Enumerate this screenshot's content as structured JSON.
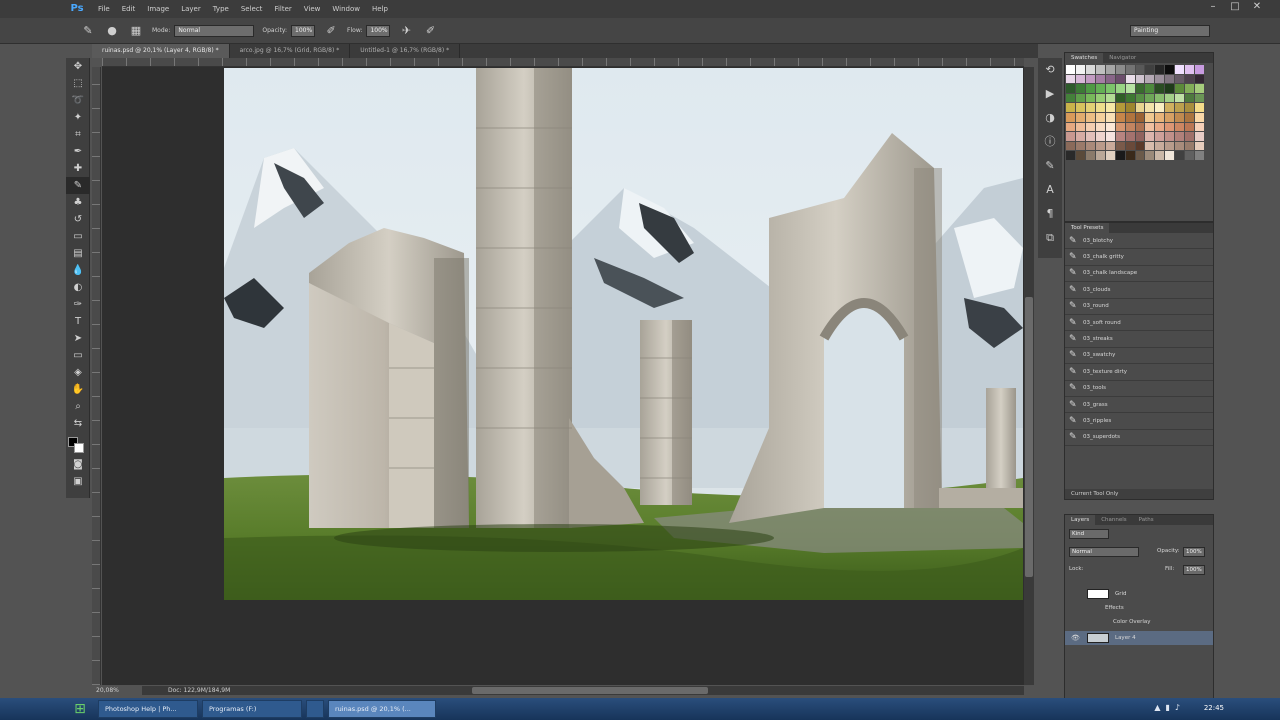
{
  "app": {
    "logo": "Ps"
  },
  "menu": [
    "File",
    "Edit",
    "Image",
    "Layer",
    "Type",
    "Select",
    "Filter",
    "View",
    "Window",
    "Help"
  ],
  "window_controls": {
    "minimize": "–",
    "maximize": "□",
    "close": "✕"
  },
  "options": {
    "mode_label": "Mode:",
    "mode_value": "Normal",
    "opacity_label": "Opacity:",
    "opacity_value": "100%",
    "flow_label": "Flow:",
    "flow_value": "100%",
    "workspace": "Painting"
  },
  "tabs": [
    {
      "label": "ruinas.psd @ 20,1% (Layer 4, RGB/8) *",
      "active": true
    },
    {
      "label": "arco.jpg @ 16,7% (Grid, RGB/8) *",
      "active": false
    },
    {
      "label": "Untitled-1 @ 16,7% (RGB/8) *",
      "active": false
    }
  ],
  "status": {
    "zoom": "20,08%",
    "doc": "Doc: 122,9M/184,9M"
  },
  "swatches": {
    "colors": [
      "#ffffff",
      "#f2f2f2",
      "#d9d9d9",
      "#bfbfbf",
      "#a6a6a6",
      "#8c8c8c",
      "#737373",
      "#595959",
      "#404040",
      "#262626",
      "#0d0d0d",
      "#f0e0ff",
      "#e0c0f0",
      "#c89be0",
      "#e8d6e8",
      "#d7b8d7",
      "#c29bc2",
      "#a57ea5",
      "#886588",
      "#6b4d6b",
      "#e9dde9",
      "#cfc3cf",
      "#b5a9b5",
      "#9b8f9b",
      "#817581",
      "#675b67",
      "#4d414d",
      "#332733",
      "#2e5a2b",
      "#3d7a36",
      "#4f9a44",
      "#64b055",
      "#7cc46a",
      "#99d584",
      "#b7e3a3",
      "#3a6b2f",
      "#4d8a3c",
      "#2a4d22",
      "#1f3b1a",
      "#5c8a3a",
      "#82ad58",
      "#a6cc7c",
      "#44803a",
      "#5e9e4a",
      "#78b85a",
      "#96cc74",
      "#b3dc94",
      "#2f5e26",
      "#3e7832",
      "#568f44",
      "#6ea658",
      "#88bc6e",
      "#a3cf88",
      "#c0e0a6",
      "#4e7a3e",
      "#6b9656",
      "#c8b24a",
      "#d6c25e",
      "#e2d074",
      "#eedd8c",
      "#f6e8a6",
      "#b39a3a",
      "#9d852e",
      "#e8d490",
      "#f2e2aa",
      "#faeec4",
      "#d0b060",
      "#bca04e",
      "#a88e3e",
      "#f4dc8a",
      "#d89a5a",
      "#e2ac6e",
      "#ecbe84",
      "#f4d09c",
      "#f8e0b6",
      "#c6864a",
      "#b0743e",
      "#9a6234",
      "#f0c890",
      "#e8b47a",
      "#d6a064",
      "#c08a50",
      "#aa7440",
      "#fad8a8",
      "#e6a880",
      "#eebc98",
      "#f4ceb0",
      "#f8dcc4",
      "#fce8d8",
      "#d69670",
      "#c28460",
      "#ac7252",
      "#f0c0a0",
      "#e8aa88",
      "#dc9674",
      "#cc8662",
      "#ba7654",
      "#f6d0b8",
      "#c89890",
      "#d6aca4",
      "#e2c0ba",
      "#eed4ce",
      "#f6e4e0",
      "#b88480",
      "#a4726e",
      "#90625e",
      "#dcb4ac",
      "#cea09a",
      "#c0908a",
      "#b0807a",
      "#a0706a",
      "#e8ccc6",
      "#8a6a5a",
      "#9a7a6a",
      "#aa8a7a",
      "#ba9a8a",
      "#caaa9a",
      "#7a5a4a",
      "#6a4a3a",
      "#5a3a2a",
      "#d8bcac",
      "#c8ac9c",
      "#b89c8c",
      "#a88c7c",
      "#987c6c",
      "#e6ccbc",
      "#2a2a2a",
      "#5a4a3a",
      "#8a7a6a",
      "#baa898",
      "#e0d0c0",
      "#1a1a1a",
      "#3a2a1a",
      "#6a5a4a",
      "#9a8a7a",
      "#cab8a8",
      "#f0e6da",
      "#404040",
      "#606060",
      "#808080"
    ]
  },
  "panel_tabs": {
    "swatches": [
      "Swatches",
      "Navigator"
    ],
    "presets": [
      "Tool Presets"
    ],
    "layers": [
      "Layers",
      "Channels",
      "Paths"
    ]
  },
  "tool_presets": [
    "03_blotchy",
    "03_chalk gritty",
    "03_chalk landscape",
    "03_clouds",
    "03_round",
    "03_soft round",
    "03_streaks",
    "03_swatchy",
    "03_texture dirty",
    "03_tools",
    "03_grass",
    "03_ripples",
    "03_superdots"
  ],
  "tool_presets_footer": "Current Tool Only",
  "layers": {
    "kind": "Kind",
    "blend": "Normal",
    "opacity_label": "Opacity:",
    "opacity_value": "100%",
    "lock_label": "Lock:",
    "fill_label": "Fill:",
    "fill_value": "100%",
    "items": [
      {
        "name": "Grid",
        "sub": [
          "Effects",
          "Color Overlay"
        ]
      },
      {
        "name": "Layer 4"
      }
    ]
  },
  "taskbar": {
    "tasks": [
      {
        "label": "Photoshop Help | Ph...",
        "active": false
      },
      {
        "label": "Programas (F:)",
        "active": false
      },
      {
        "label": "",
        "active": false
      },
      {
        "label": "ruinas.psd @ 20,1% (...",
        "active": true
      }
    ],
    "clock": "22:45"
  }
}
